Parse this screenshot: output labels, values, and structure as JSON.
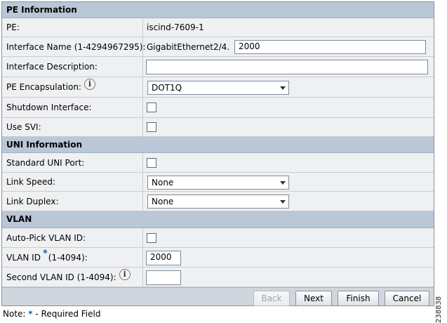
{
  "sections": {
    "pe": "PE Information",
    "uni": "UNI Information",
    "vlan": "VLAN"
  },
  "pe": {
    "pe_label": "PE:",
    "pe_value": "iscind-7609-1",
    "ifname_label": "Interface Name (1-4294967295):",
    "ifname_prefix": "GigabitEthernet2/4.",
    "ifname_value": "2000",
    "ifdesc_label": "Interface Description:",
    "ifdesc_value": "",
    "encap_label": "PE Encapsulation:",
    "encap_value": "DOT1Q",
    "shutdown_label": "Shutdown Interface:",
    "svi_label": "Use SVI:"
  },
  "uni": {
    "std_port_label": "Standard UNI Port:",
    "link_speed_label": "Link Speed:",
    "link_speed_value": "None",
    "link_duplex_label": "Link Duplex:",
    "link_duplex_value": "None"
  },
  "vlan": {
    "autopick_label": "Auto-Pick VLAN ID:",
    "vlan_id_label_a": "VLAN ID",
    "vlan_id_label_b": "(1-4094):",
    "vlan_id_value": "2000",
    "second_vlan_label": "Second VLAN ID (1-4094):",
    "second_vlan_value": ""
  },
  "buttons": {
    "back": "Back",
    "next": "Next",
    "finish": "Finish",
    "cancel": "Cancel"
  },
  "note": {
    "prefix": "Note:",
    "star": "*",
    "text": "- Required Field"
  },
  "figure_id": "238838",
  "info_icon_glyph": "i",
  "required_marker": "*"
}
